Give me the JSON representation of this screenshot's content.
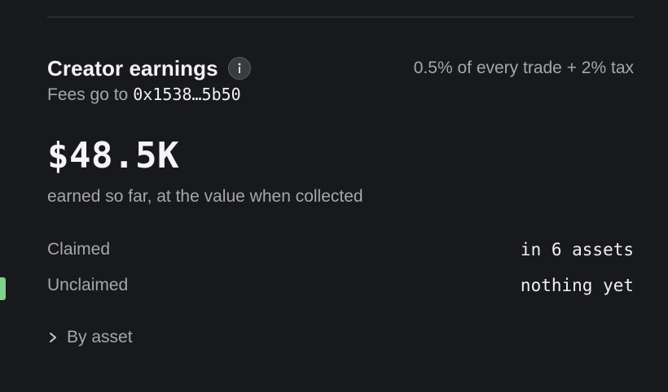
{
  "earnings": {
    "title": "Creator earnings",
    "fee_rate": "0.5% of every trade + 2% tax",
    "fees_prefix": "Fees go to",
    "fees_address": "0x1538…5b50",
    "amount": "$48.5K",
    "amount_caption": "earned so far, at the value when collected",
    "rows": [
      {
        "label": "Claimed",
        "value": "in 6 assets"
      },
      {
        "label": "Unclaimed",
        "value": "nothing yet"
      }
    ],
    "by_asset_label": "By asset"
  },
  "icons": {
    "info": "info-icon",
    "expand": "chevron-right-icon"
  },
  "colors": {
    "background": "#18191b",
    "primary_text": "#f2f2f4",
    "secondary_text": "#a6a7ab",
    "accent_marker": "#7fd08b"
  }
}
